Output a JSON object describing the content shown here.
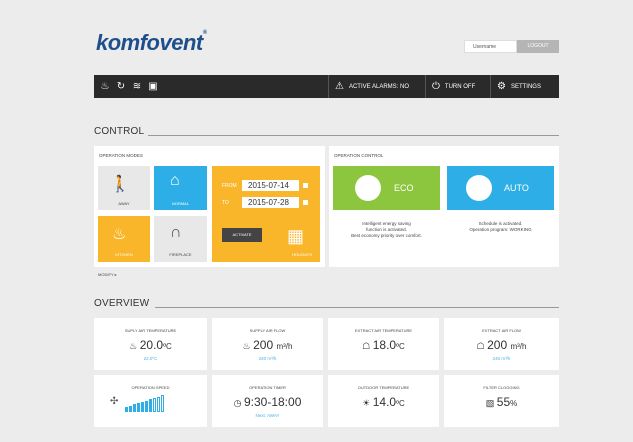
{
  "brand": {
    "logo": "komfovent"
  },
  "header": {
    "username_placeholder": "Username",
    "logout_label": "LOGOUT"
  },
  "topbar": {
    "alarms_label": "ACTIVE ALARMS: NO",
    "turn_off_label": "TURN OFF",
    "settings_label": "SETTINGS"
  },
  "control": {
    "title": "CONTROL",
    "operation_modes": {
      "label": "OPERATION MODES",
      "away": "AWAY",
      "normal": "NORMAL",
      "kitchen": "KITCHEN",
      "fireplace": "FIREPLACE",
      "holidays": {
        "label": "HOLIDAYS",
        "from_label": "FROM",
        "to_label": "TO",
        "from_date": "2015-07-14",
        "to_date": "2015-07-28",
        "activate_label": "ACTIVATE"
      },
      "modify_label": "MODIFY ▸"
    },
    "operation_control": {
      "label": "OPERATION CONTROL",
      "eco": {
        "label": "ECO",
        "desc1": "Intelligent energy saving",
        "desc2": "function is activated.",
        "desc3": "Best economy priority over comfort."
      },
      "auto": {
        "label": "AUTO",
        "desc1": "Schedule is activated.",
        "desc2": "Operation program: WORKING"
      }
    }
  },
  "overview": {
    "title": "OVERVIEW",
    "cards": [
      {
        "title": "SUPLY AIR TEMPERATURE",
        "value": "20.0",
        "unit": "ºC",
        "sub": "22.0ºC"
      },
      {
        "title": "SUPPLY AIR FLOW",
        "value": "200",
        "unit": "m³/h",
        "sub": "240 m³/h"
      },
      {
        "title": "EXTRACT AIR TEMPERATURE",
        "value": "18.0",
        "unit": "ºC",
        "sub": ""
      },
      {
        "title": "EXTRACT AIR FLOW",
        "value": "200",
        "unit": "m³/h",
        "sub": "240 m³/h"
      },
      {
        "title": "OPERATION SPEED",
        "value": "",
        "unit": "",
        "sub": "",
        "level": 0.7
      },
      {
        "title": "OPERATION TIMER",
        "value": "9:30-18:00",
        "unit": "",
        "sub": "Next: AWAY"
      },
      {
        "title": "OUTDOOR TEMPERATURE",
        "value": "14.0",
        "unit": "ºC",
        "sub": ""
      },
      {
        "title": "FILTER CLOGGING",
        "value": "55",
        "unit": "%",
        "sub": ""
      }
    ]
  },
  "colors": {
    "green": "#8cc63e",
    "blue": "#2eaee6",
    "orange": "#f9b62b",
    "dark": "#2a2a2a"
  },
  "icons": {
    "topbar": [
      "heating-icon",
      "refresh-icon",
      "heater-icon",
      "document-icon"
    ],
    "alarm": "warning-icon",
    "power": "power-icon",
    "settings": "gear-icon"
  }
}
